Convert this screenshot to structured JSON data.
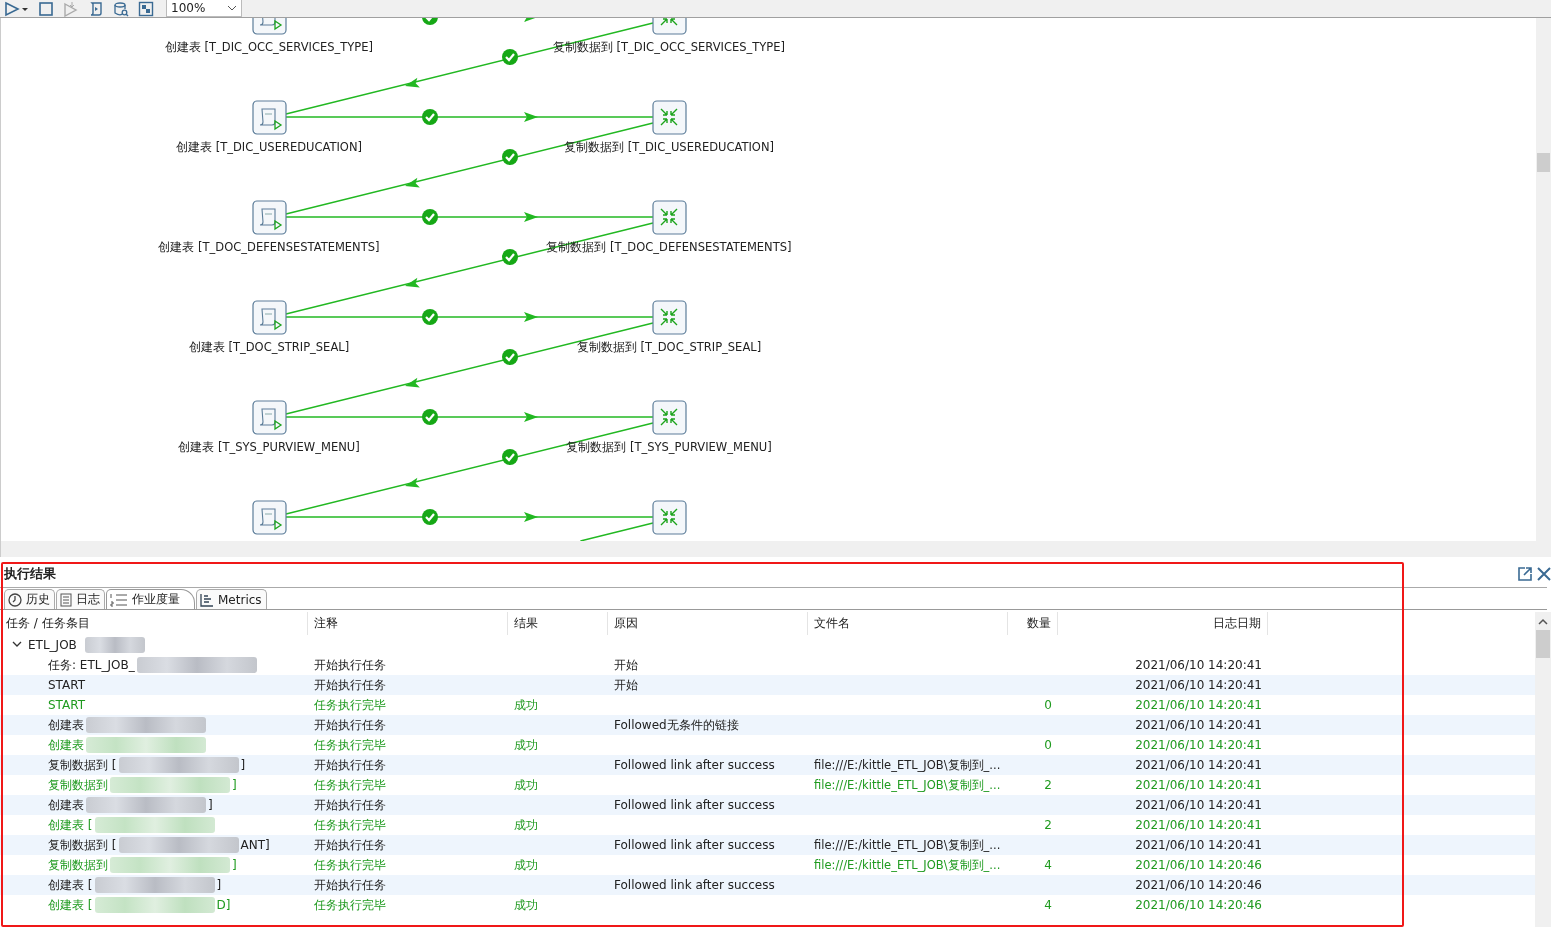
{
  "toolbar": {
    "zoom": "100%"
  },
  "canvas": {
    "rows": [
      {
        "left": {
          "kind": "sql",
          "label": "创建表 [T_DIC_OCC_SERVICES_TYPE]"
        },
        "right": {
          "kind": "transform",
          "label": "复制数据到 [T_DIC_OCC_SERVICES_TYPE]"
        }
      },
      {
        "left": {
          "kind": "sql",
          "label": "创建表 [T_DIC_USEREDUCATION]"
        },
        "right": {
          "kind": "transform",
          "label": "复制数据到 [T_DIC_USEREDUCATION]"
        }
      },
      {
        "left": {
          "kind": "sql",
          "label": "创建表 [T_DOC_DEFENSESTATEMENTS]"
        },
        "right": {
          "kind": "transform",
          "label": "复制数据到 [T_DOC_DEFENSESTATEMENTS]"
        }
      },
      {
        "left": {
          "kind": "sql",
          "label": "创建表 [T_DOC_STRIP_SEAL]"
        },
        "right": {
          "kind": "transform",
          "label": "复制数据到 [T_DOC_STRIP_SEAL]"
        }
      },
      {
        "left": {
          "kind": "sql",
          "label": "创建表 [T_SYS_PURVIEW_MENU]"
        },
        "right": {
          "kind": "transform",
          "label": "复制数据到 [T_SYS_PURVIEW_MENU]"
        }
      },
      {
        "left": {
          "kind": "sql"
        },
        "right": {
          "kind": "transform"
        }
      }
    ]
  },
  "panel": {
    "title": "执行结果",
    "tabs": [
      {
        "label": "历史",
        "selected": false
      },
      {
        "label": "日志",
        "selected": false
      },
      {
        "label": "作业度量",
        "selected": true
      },
      {
        "label": "Metrics",
        "selected": false
      }
    ],
    "table": {
      "columns": [
        "任务 / 任务条目",
        "注释",
        "结果",
        "原因",
        "文件名",
        "数量",
        "日志日期"
      ],
      "tree": {
        "name": "ETL_JOB",
        "redacted": true,
        "expanded": true,
        "children": [
          {
            "kind": "started",
            "name": "任务: ETL_JOB_",
            "redacted": true,
            "comment": "开始执行任务",
            "reason": "开始",
            "date": "2021/06/10 14:20:41"
          },
          {
            "kind": "started",
            "name": "START",
            "redacted": false,
            "comment": "开始执行任务",
            "reason": "开始",
            "date": "2021/06/10 14:20:41"
          },
          {
            "kind": "finished",
            "name": "START",
            "redacted": false,
            "comment": "任务执行完毕",
            "result": "成功",
            "count": "0",
            "date": "2021/06/10 14:20:41"
          },
          {
            "kind": "started",
            "name": "创建表",
            "redacted": true,
            "comment": "开始执行任务",
            "reason": "Followed无条件的链接",
            "date": "2021/06/10 14:20:41"
          },
          {
            "kind": "finished",
            "name": "创建表",
            "redacted": true,
            "comment": "任务执行完毕",
            "result": "成功",
            "count": "0",
            "date": "2021/06/10 14:20:41"
          },
          {
            "kind": "started",
            "name": "复制数据到 [",
            "redacted": true,
            "name_end": "]",
            "comment": "开始执行任务",
            "reason": "Followed link after success",
            "file": "file:///E:/kittle_ETL_JOB\\复制到_...",
            "date": "2021/06/10 14:20:41"
          },
          {
            "kind": "finished",
            "name": "复制数据到",
            "redacted": true,
            "name_end": "]",
            "comment": "任务执行完毕",
            "result": "成功",
            "file": "file:///E:/kittle_ETL_JOB\\复制到_...",
            "count": "2",
            "date": "2021/06/10 14:20:41"
          },
          {
            "kind": "started",
            "name": "创建表",
            "redacted": true,
            "name_end": "]",
            "comment": "开始执行任务",
            "reason": "Followed link after success",
            "date": "2021/06/10 14:20:41"
          },
          {
            "kind": "finished",
            "name": "创建表 [",
            "redacted": true,
            "comment": "任务执行完毕",
            "result": "成功",
            "count": "2",
            "date": "2021/06/10 14:20:41"
          },
          {
            "kind": "started",
            "name": "复制数据到 [",
            "redacted": true,
            "name_end": "ANT]",
            "comment": "开始执行任务",
            "reason": "Followed link after success",
            "file": "file:///E:/kittle_ETL_JOB\\复制到_...",
            "date": "2021/06/10 14:20:41"
          },
          {
            "kind": "finished",
            "name": "复制数据到",
            "redacted": true,
            "name_end": "]",
            "comment": "任务执行完毕",
            "result": "成功",
            "file": "file:///E:/kittle_ETL_JOB\\复制到_...",
            "count": "4",
            "date": "2021/06/10 14:20:46"
          },
          {
            "kind": "started",
            "name": "创建表 [",
            "redacted": true,
            "name_end": "]",
            "comment": "开始执行任务",
            "reason": "Followed link after success",
            "date": "2021/06/10 14:20:46"
          },
          {
            "kind": "finished",
            "name": "创建表 [",
            "redacted": true,
            "name_end": "D]",
            "comment": "任务执行完毕",
            "result": "成功",
            "count": "4",
            "date": "2021/06/10 14:20:46"
          }
        ]
      }
    }
  }
}
